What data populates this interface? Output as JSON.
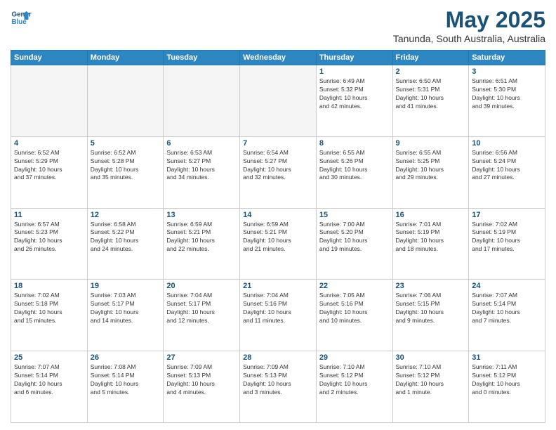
{
  "header": {
    "logo_line1": "General",
    "logo_line2": "Blue",
    "title": "May 2025",
    "subtitle": "Tanunda, South Australia, Australia"
  },
  "weekdays": [
    "Sunday",
    "Monday",
    "Tuesday",
    "Wednesday",
    "Thursday",
    "Friday",
    "Saturday"
  ],
  "weeks": [
    [
      {
        "day": "",
        "info": ""
      },
      {
        "day": "",
        "info": ""
      },
      {
        "day": "",
        "info": ""
      },
      {
        "day": "",
        "info": ""
      },
      {
        "day": "1",
        "info": "Sunrise: 6:49 AM\nSunset: 5:32 PM\nDaylight: 10 hours\nand 42 minutes."
      },
      {
        "day": "2",
        "info": "Sunrise: 6:50 AM\nSunset: 5:31 PM\nDaylight: 10 hours\nand 41 minutes."
      },
      {
        "day": "3",
        "info": "Sunrise: 6:51 AM\nSunset: 5:30 PM\nDaylight: 10 hours\nand 39 minutes."
      }
    ],
    [
      {
        "day": "4",
        "info": "Sunrise: 6:52 AM\nSunset: 5:29 PM\nDaylight: 10 hours\nand 37 minutes."
      },
      {
        "day": "5",
        "info": "Sunrise: 6:52 AM\nSunset: 5:28 PM\nDaylight: 10 hours\nand 35 minutes."
      },
      {
        "day": "6",
        "info": "Sunrise: 6:53 AM\nSunset: 5:27 PM\nDaylight: 10 hours\nand 34 minutes."
      },
      {
        "day": "7",
        "info": "Sunrise: 6:54 AM\nSunset: 5:27 PM\nDaylight: 10 hours\nand 32 minutes."
      },
      {
        "day": "8",
        "info": "Sunrise: 6:55 AM\nSunset: 5:26 PM\nDaylight: 10 hours\nand 30 minutes."
      },
      {
        "day": "9",
        "info": "Sunrise: 6:55 AM\nSunset: 5:25 PM\nDaylight: 10 hours\nand 29 minutes."
      },
      {
        "day": "10",
        "info": "Sunrise: 6:56 AM\nSunset: 5:24 PM\nDaylight: 10 hours\nand 27 minutes."
      }
    ],
    [
      {
        "day": "11",
        "info": "Sunrise: 6:57 AM\nSunset: 5:23 PM\nDaylight: 10 hours\nand 26 minutes."
      },
      {
        "day": "12",
        "info": "Sunrise: 6:58 AM\nSunset: 5:22 PM\nDaylight: 10 hours\nand 24 minutes."
      },
      {
        "day": "13",
        "info": "Sunrise: 6:59 AM\nSunset: 5:21 PM\nDaylight: 10 hours\nand 22 minutes."
      },
      {
        "day": "14",
        "info": "Sunrise: 6:59 AM\nSunset: 5:21 PM\nDaylight: 10 hours\nand 21 minutes."
      },
      {
        "day": "15",
        "info": "Sunrise: 7:00 AM\nSunset: 5:20 PM\nDaylight: 10 hours\nand 19 minutes."
      },
      {
        "day": "16",
        "info": "Sunrise: 7:01 AM\nSunset: 5:19 PM\nDaylight: 10 hours\nand 18 minutes."
      },
      {
        "day": "17",
        "info": "Sunrise: 7:02 AM\nSunset: 5:19 PM\nDaylight: 10 hours\nand 17 minutes."
      }
    ],
    [
      {
        "day": "18",
        "info": "Sunrise: 7:02 AM\nSunset: 5:18 PM\nDaylight: 10 hours\nand 15 minutes."
      },
      {
        "day": "19",
        "info": "Sunrise: 7:03 AM\nSunset: 5:17 PM\nDaylight: 10 hours\nand 14 minutes."
      },
      {
        "day": "20",
        "info": "Sunrise: 7:04 AM\nSunset: 5:17 PM\nDaylight: 10 hours\nand 12 minutes."
      },
      {
        "day": "21",
        "info": "Sunrise: 7:04 AM\nSunset: 5:16 PM\nDaylight: 10 hours\nand 11 minutes."
      },
      {
        "day": "22",
        "info": "Sunrise: 7:05 AM\nSunset: 5:16 PM\nDaylight: 10 hours\nand 10 minutes."
      },
      {
        "day": "23",
        "info": "Sunrise: 7:06 AM\nSunset: 5:15 PM\nDaylight: 10 hours\nand 9 minutes."
      },
      {
        "day": "24",
        "info": "Sunrise: 7:07 AM\nSunset: 5:14 PM\nDaylight: 10 hours\nand 7 minutes."
      }
    ],
    [
      {
        "day": "25",
        "info": "Sunrise: 7:07 AM\nSunset: 5:14 PM\nDaylight: 10 hours\nand 6 minutes."
      },
      {
        "day": "26",
        "info": "Sunrise: 7:08 AM\nSunset: 5:14 PM\nDaylight: 10 hours\nand 5 minutes."
      },
      {
        "day": "27",
        "info": "Sunrise: 7:09 AM\nSunset: 5:13 PM\nDaylight: 10 hours\nand 4 minutes."
      },
      {
        "day": "28",
        "info": "Sunrise: 7:09 AM\nSunset: 5:13 PM\nDaylight: 10 hours\nand 3 minutes."
      },
      {
        "day": "29",
        "info": "Sunrise: 7:10 AM\nSunset: 5:12 PM\nDaylight: 10 hours\nand 2 minutes."
      },
      {
        "day": "30",
        "info": "Sunrise: 7:10 AM\nSunset: 5:12 PM\nDaylight: 10 hours\nand 1 minute."
      },
      {
        "day": "31",
        "info": "Sunrise: 7:11 AM\nSunset: 5:12 PM\nDaylight: 10 hours\nand 0 minutes."
      }
    ]
  ]
}
